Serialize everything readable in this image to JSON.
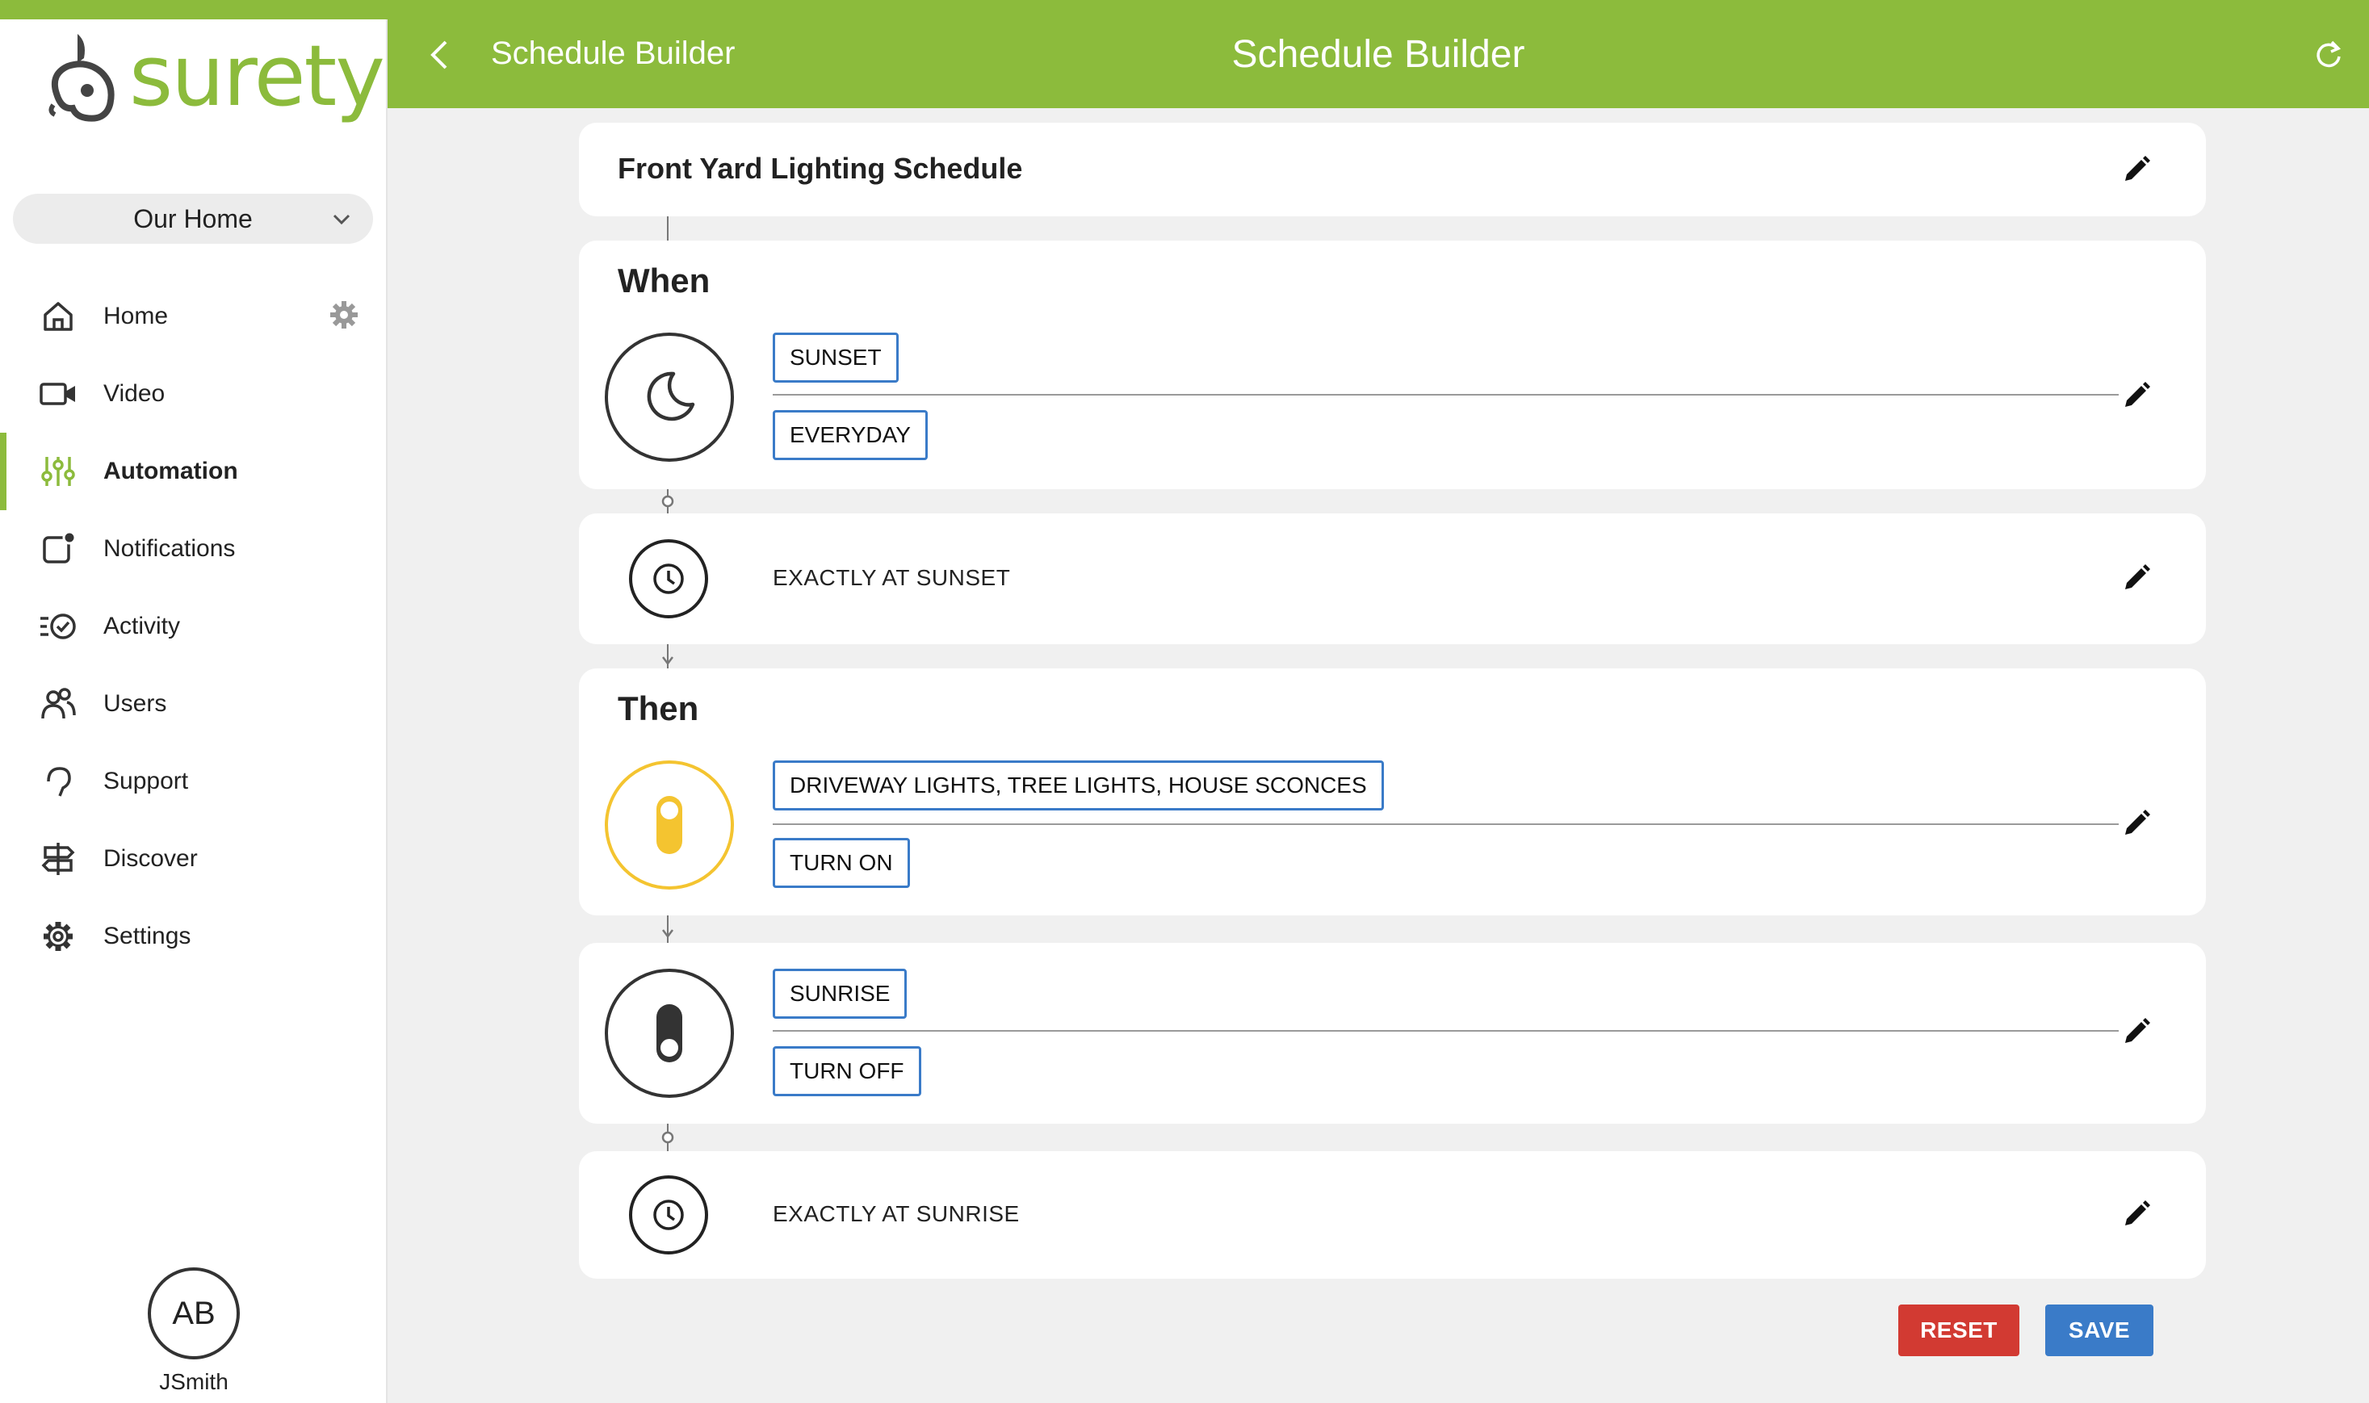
{
  "app": {
    "brand": "surety",
    "brand_color": "#8cbb3c",
    "accent_blue": "#3a7bc8",
    "danger_red": "#d23a32"
  },
  "location_select": {
    "value": "Our Home",
    "icon": "chevron-down-icon"
  },
  "sidebar": {
    "items": [
      {
        "label": "Home",
        "icon": "home-icon"
      },
      {
        "label": "Video",
        "icon": "video-camera-icon"
      },
      {
        "label": "Automation",
        "icon": "sliders-icon",
        "active": true
      },
      {
        "label": "Notifications",
        "icon": "notification-icon"
      },
      {
        "label": "Activity",
        "icon": "activity-icon"
      },
      {
        "label": "Users",
        "icon": "users-icon"
      },
      {
        "label": "Support",
        "icon": "support-icon"
      },
      {
        "label": "Discover",
        "icon": "signpost-icon"
      },
      {
        "label": "Settings",
        "icon": "gear-icon"
      }
    ],
    "user": {
      "initials": "AB",
      "name": "JSmith"
    }
  },
  "header": {
    "breadcrumb": "Schedule Builder",
    "title": "Schedule Builder"
  },
  "schedule": {
    "name": "Front Yard Lighting Schedule",
    "when": {
      "heading": "When",
      "icon": "moon-icon",
      "trigger": "SUNSET",
      "days": "EVERYDAY",
      "timing": "EXACTLY AT SUNSET"
    },
    "then": {
      "heading": "Then",
      "action1": {
        "icon": "light-switch-on-icon",
        "devices": "DRIVEWAY LIGHTS, TREE LIGHTS, HOUSE SCONCES",
        "command": "TURN ON",
        "color": "#f4c430"
      },
      "action2": {
        "icon": "light-switch-off-icon",
        "trigger": "SUNRISE",
        "command": "TURN OFF",
        "timing": "EXACTLY AT SUNRISE"
      }
    }
  },
  "actions": {
    "reset": "RESET",
    "save": "SAVE"
  }
}
